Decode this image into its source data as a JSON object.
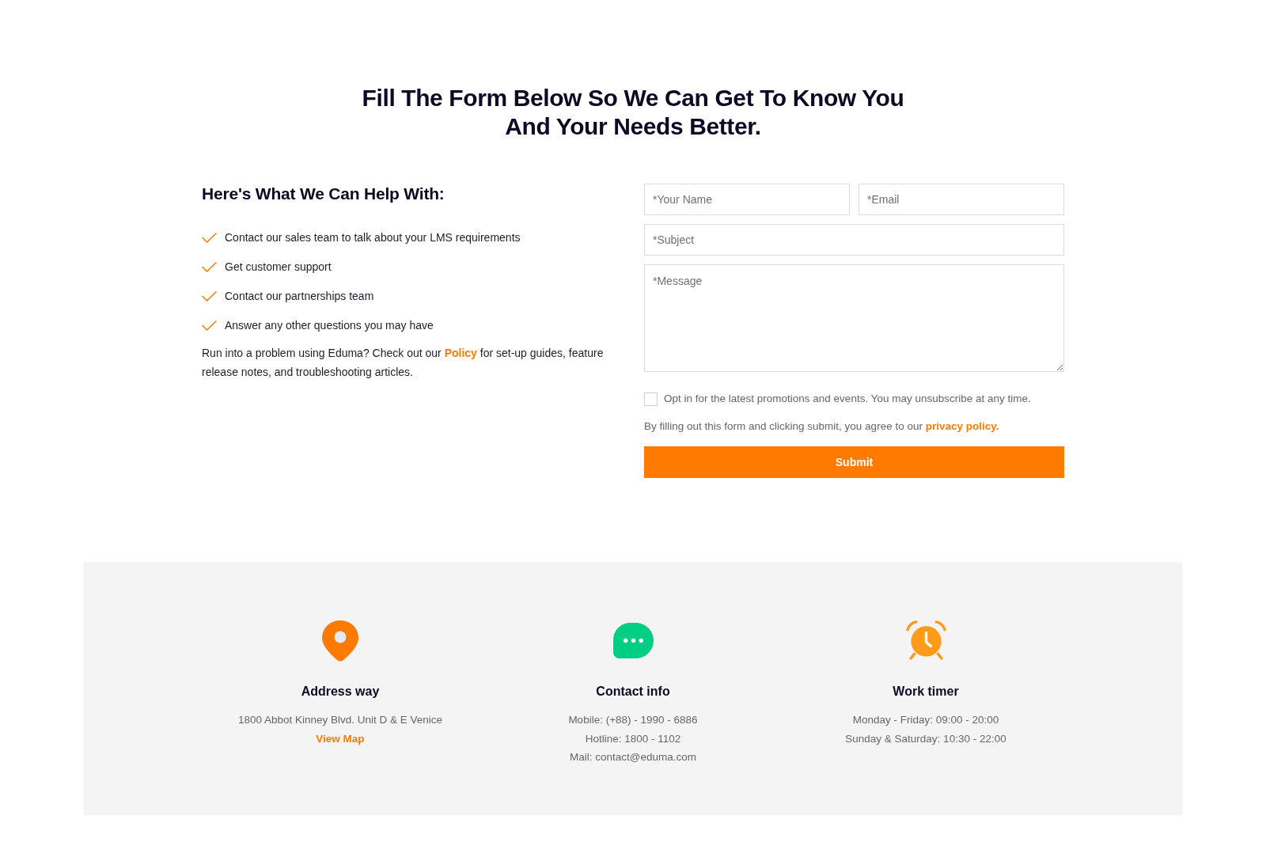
{
  "heading": "Fill The Form Below So We Can Get To Know You And Your Needs Better.",
  "help": {
    "title": "Here's What We Can Help With:",
    "items": [
      "Contact our sales team to talk about your LMS requirements",
      "Get customer support",
      "Contact our partnerships team",
      "Answer any other questions you may have"
    ],
    "note": {
      "before": "Run into a problem using Eduma? Check out our",
      "link": "Policy",
      "after": "for set-up guides, feature release notes, and troubleshooting articles."
    }
  },
  "form": {
    "rows": [
      [
        {
          "kind": "input",
          "placeholder": "*Your Name"
        },
        {
          "kind": "input",
          "placeholder": "*Email"
        }
      ],
      [
        {
          "kind": "input",
          "placeholder": "*Subject"
        }
      ],
      [
        {
          "kind": "textarea",
          "placeholder": "*Message"
        }
      ]
    ],
    "opt_in": {
      "label": "Opt in for the latest promotions and events. You may unsubscribe at any time.",
      "checked": false
    },
    "consent": {
      "before": "By filling out this form and clicking submit, you agree to our",
      "link": "privacy policy."
    },
    "submit": "Submit"
  },
  "info": [
    {
      "kind": "address",
      "title": "Address way",
      "lines": [
        "1800 Abbot Kinney Blvd. Unit D & E Venice"
      ],
      "link": "View Map"
    },
    {
      "kind": "contact",
      "title": "Contact info",
      "lines": [
        "Mobile: (+88) - 1990 - 6886",
        "Hotline: 1800 - 1102",
        "Mail: contact@eduma.com"
      ]
    },
    {
      "kind": "hours",
      "title": "Work timer",
      "lines": [
        "Monday - Friday: 09:00 - 20:00",
        "Sunday & Saturday: 10:30 - 22:00"
      ]
    }
  ]
}
